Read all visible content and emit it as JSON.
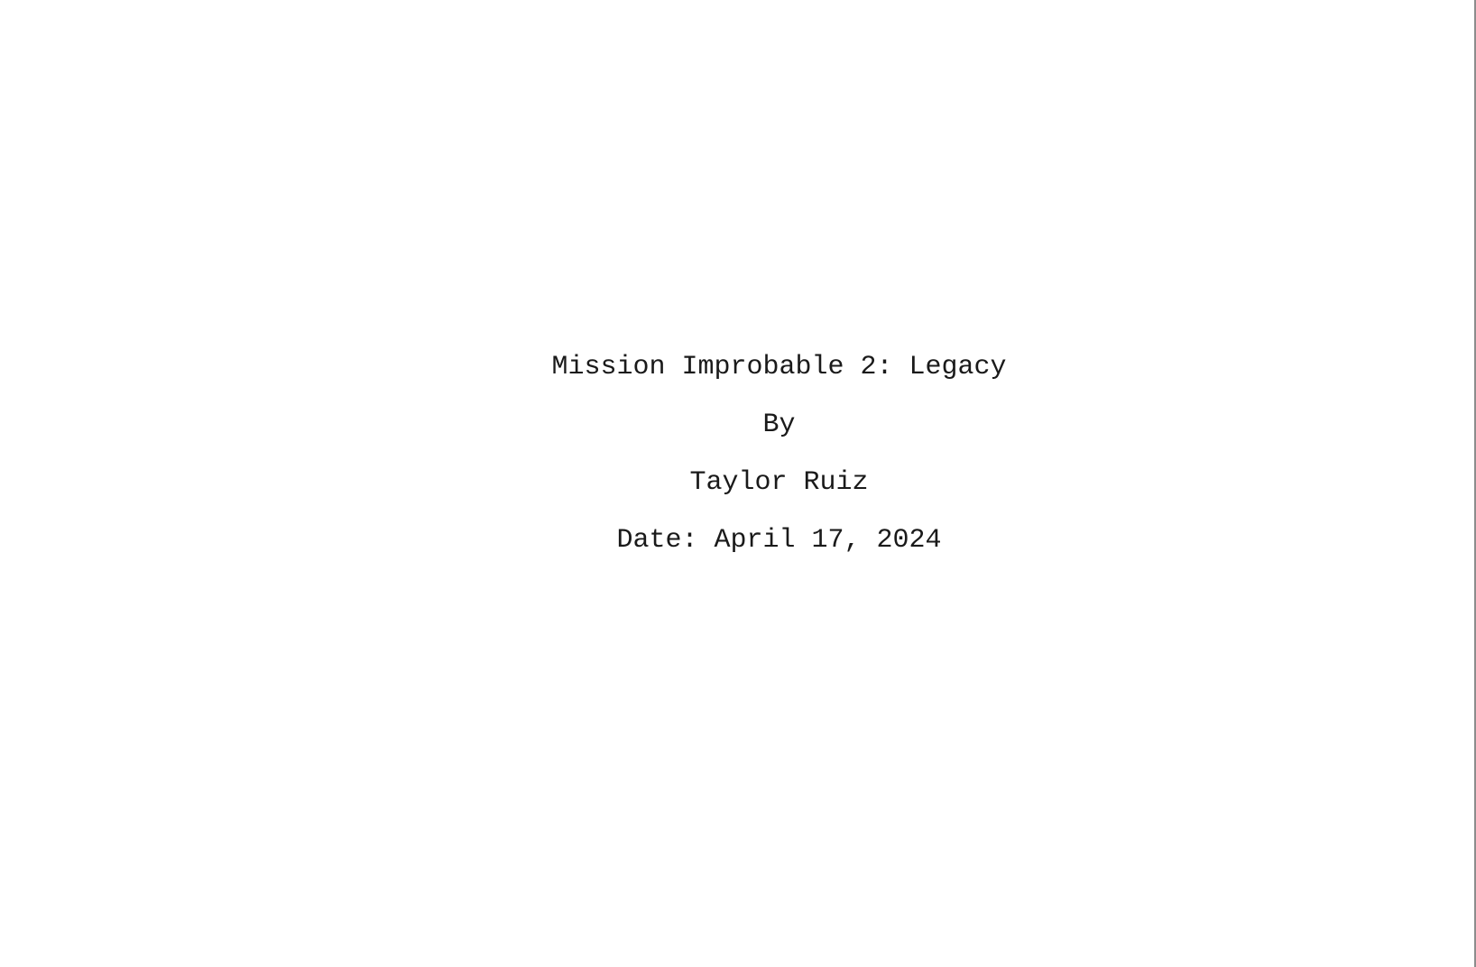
{
  "title_page": {
    "title": "Mission Improbable 2: Legacy",
    "by": "By",
    "author": "Taylor Ruiz",
    "date": "Date: April 17, 2024"
  }
}
